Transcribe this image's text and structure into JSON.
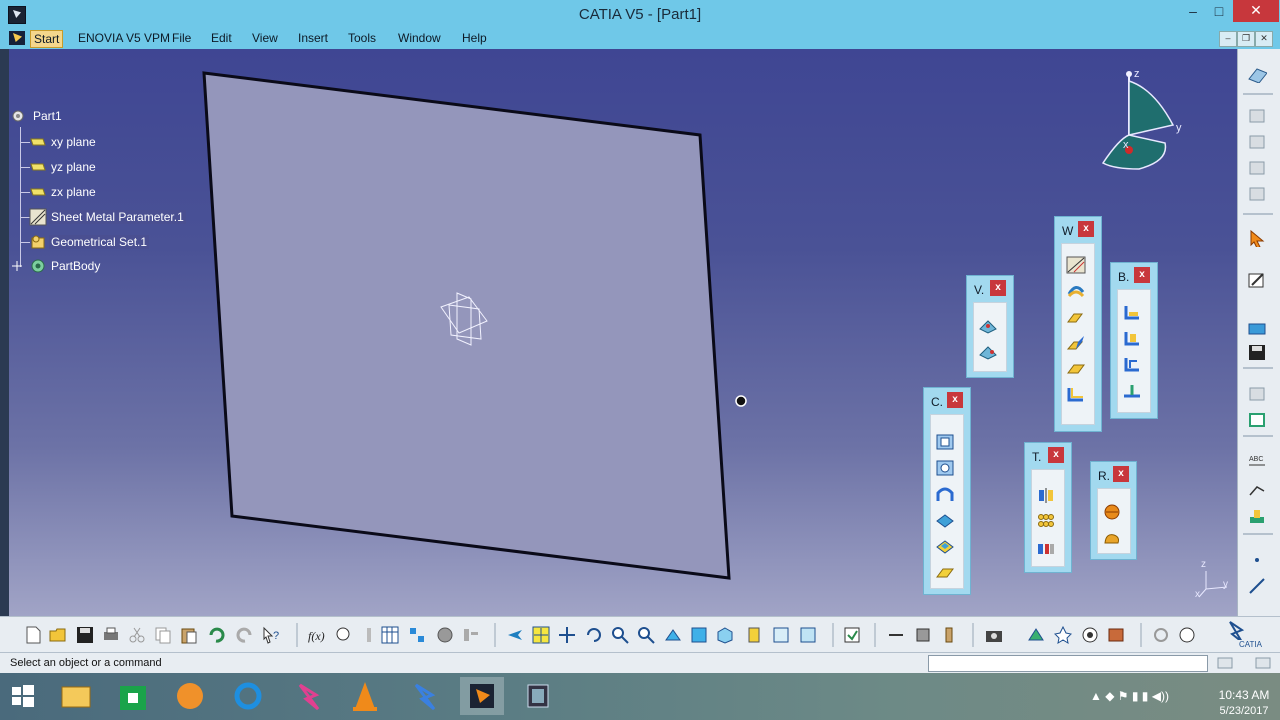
{
  "window": {
    "title": "CATIA V5 - [Part1]",
    "minimize_symbol": "–",
    "maximize_symbol": "□",
    "close_symbol": "✕"
  },
  "menu": {
    "start": "Start",
    "items": [
      "ENOVIA V5 VPM",
      "File",
      "Edit",
      "View",
      "Insert",
      "Tools",
      "Window",
      "Help"
    ],
    "mdi_minimize": "–",
    "mdi_restore": "❐",
    "mdi_close": "✕"
  },
  "tree": {
    "root": "Part1",
    "items": [
      {
        "label": "xy plane",
        "icon": "plane-icon"
      },
      {
        "label": "yz plane",
        "icon": "plane-icon"
      },
      {
        "label": "zx plane",
        "icon": "plane-icon"
      },
      {
        "label": "Sheet Metal Parameter.1",
        "icon": "sheet-metal-parameter-icon"
      },
      {
        "label": "Geometrical Set.1",
        "icon": "geometrical-set-icon"
      },
      {
        "label": "PartBody",
        "icon": "partbody-icon"
      }
    ]
  },
  "compass": {
    "x": "x",
    "y": "y",
    "z": "z"
  },
  "mini_axis": {
    "x": "x",
    "y": "y",
    "z": "z"
  },
  "floating_toolbars": {
    "views": {
      "title": "V.",
      "close": "x",
      "icons": [
        "views-icon",
        "snap-views-icon"
      ]
    },
    "walls": {
      "title": "W",
      "close": "x",
      "icons": [
        "sheet-metal-parameters-icon",
        "recognize-icon",
        "flange-icon",
        "wall-on-edge-icon",
        "extrusion-icon",
        "bend-icon"
      ]
    },
    "bends": {
      "title": "B.",
      "close": "x",
      "icons": [
        "bend-icon",
        "conical-bend-icon",
        "bend-from-flat-icon",
        "unfold-icon"
      ]
    },
    "cutting": {
      "title": "C.",
      "close": "x",
      "icons": [
        "cut-out-icon",
        "hole-icon",
        "circular-cutout-icon",
        "corner-relief-icon",
        "stamp-icon",
        "surface-stamp-icon"
      ]
    },
    "transform": {
      "title": "T.",
      "close": "x",
      "icons": [
        "mirror-icon",
        "rectangular-pattern-icon",
        "transformations-icon"
      ]
    },
    "rendering": {
      "title": "R.",
      "close": "x",
      "icons": [
        "apply-material-icon",
        "apply-appearance-icon"
      ]
    }
  },
  "status": {
    "message": "Select an object or a command",
    "command_value": ""
  },
  "taskbar": {
    "time": "10:43 AM",
    "date": "5/23/2017",
    "apps": [
      "start-windows-icon",
      "file-explorer-icon",
      "store-icon",
      "uc-browser-icon",
      "internet-explorer-icon",
      "catia-icon",
      "vlc-icon",
      "catia-launcher-icon",
      "catia-v5-app-icon",
      "film-app-icon"
    ]
  },
  "colors": {
    "titlebar": "#6fc8e8",
    "viewport_top": "#3f4693",
    "viewport_bottom": "#a1a4c6",
    "sheet_fill": "#9496bb",
    "close_red": "#c7373c",
    "toolbar_bg": "#e8edf2"
  }
}
